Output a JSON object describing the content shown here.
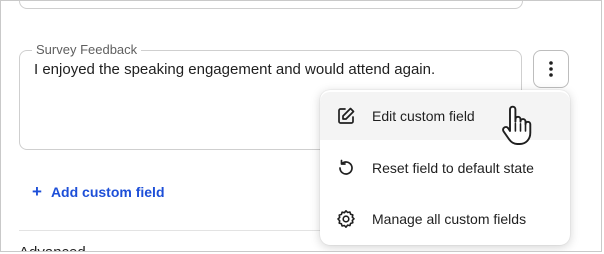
{
  "survey_field": {
    "label": "Survey Feedback",
    "value": "I enjoyed the speaking engagement and would attend again."
  },
  "options_button": {
    "icon": "kebab-vertical-icon"
  },
  "add_custom_field": {
    "plus": "+",
    "label": "Add custom field"
  },
  "context_menu": {
    "items": [
      {
        "label": "Edit custom field",
        "icon": "edit-icon",
        "hovered": true
      },
      {
        "label": "Reset field to default state",
        "icon": "reset-icon",
        "hovered": false
      },
      {
        "label": "Manage all custom fields",
        "icon": "gear-icon",
        "hovered": false
      }
    ]
  },
  "cut_off_text": "Advanced",
  "colors": {
    "link": "#1d4fd8",
    "border": "#cfcfcf",
    "hover": "#f4f4f4"
  }
}
